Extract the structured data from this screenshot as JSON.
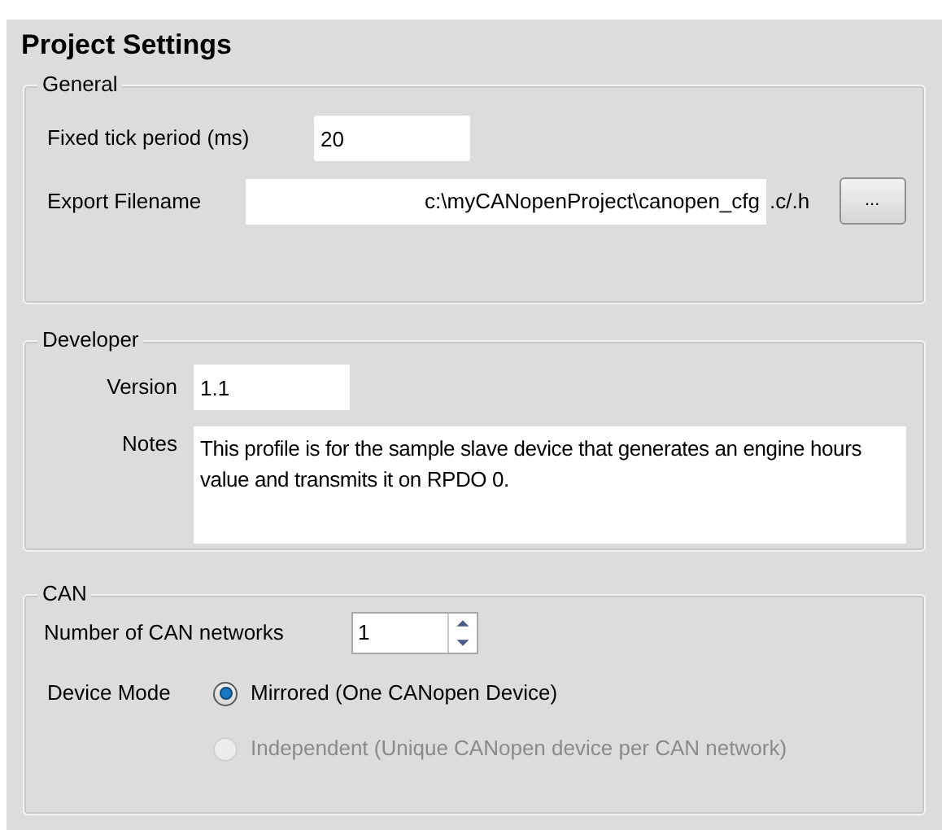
{
  "title": "Project Settings",
  "general": {
    "legend": "General",
    "tick_label": "Fixed tick period (ms)",
    "tick_value": "20",
    "export_label": "Export Filename",
    "export_value": "c:\\myCANopenProject\\canopen_cfg",
    "export_suffix": ".c/.h",
    "browse_button": "..."
  },
  "developer": {
    "legend": "Developer",
    "version_label": "Version",
    "version_value": "1.1",
    "notes_label": "Notes",
    "notes_value": "This profile is for the sample slave device that generates an engine hours value and transmits it on RPDO 0."
  },
  "can": {
    "legend": "CAN",
    "networks_label": "Number of CAN networks",
    "networks_value": "1",
    "mode_label": "Device Mode",
    "modes": [
      {
        "label": "Mirrored (One CANopen Device)",
        "selected": true,
        "disabled": false
      },
      {
        "label": "Independent (Unique CANopen device per CAN network)",
        "selected": false,
        "disabled": true
      }
    ]
  }
}
